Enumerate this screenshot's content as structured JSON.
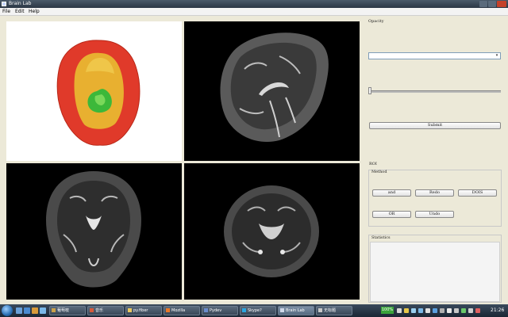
{
  "window": {
    "title": "Brain Lab"
  },
  "menu": {
    "items": [
      "File",
      "Edit",
      "Help"
    ]
  },
  "panel": {
    "opacity_label": "Opacity",
    "combo_value": "",
    "slider_fraction": 0.0,
    "submit_label": "Submit",
    "roi_label": "ROI",
    "method_label": "Method",
    "method_buttons": [
      "and",
      "Redo",
      "DOIS",
      "OR",
      "Undo"
    ],
    "statistics_label": "Statistics",
    "statistics_text": ""
  },
  "taskbar": {
    "tasks": [
      {
        "label": "葡萄枝",
        "icon_color": "#c9a14a"
      },
      {
        "label": "音乐",
        "icon_color": "#d65a3a"
      },
      {
        "label": "py.fiber",
        "icon_color": "#e8c860"
      },
      {
        "label": "Mozilla",
        "icon_color": "#e8782a"
      },
      {
        "label": "Pydev",
        "icon_color": "#6a8ccc"
      },
      {
        "label": "Skype?",
        "icon_color": "#2aa6e0"
      },
      {
        "label": "Brain Lab",
        "icon_color": "#cfd8e8"
      },
      {
        "label": "无标题",
        "icon_color": "#c8c8c8"
      }
    ],
    "language": "100%",
    "clock": "21:26"
  },
  "colors": {
    "titlebar": "#2f3b4a",
    "panel_background": "#ece9d8",
    "render_outer": "#e03a2a",
    "render_mid": "#e8b030",
    "render_inner": "#3cb83a"
  }
}
